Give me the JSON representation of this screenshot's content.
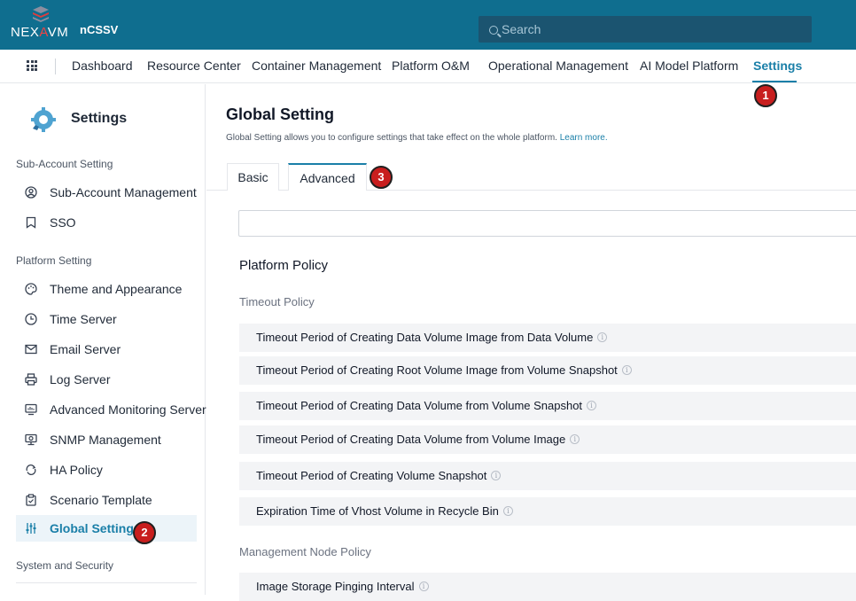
{
  "app": {
    "logo": {
      "part1": "NEX",
      "part2": "A",
      "part3": "VM"
    },
    "product": "nCSSV",
    "search_placeholder": "Search"
  },
  "nav": {
    "items": [
      "Dashboard",
      "Resource Center",
      "Container Management",
      "Platform O&M",
      "Operational Management",
      "AI Model Platform",
      "Settings"
    ],
    "active": "Settings"
  },
  "badges": [
    "1",
    "2",
    "3"
  ],
  "sidebar": {
    "title": "Settings",
    "groups": {
      "sub_account": "Sub-Account Setting",
      "platform": "Platform Setting",
      "system": "System and Security"
    },
    "items": [
      {
        "label": "Sub-Account Management",
        "icon": "user-circle-icon"
      },
      {
        "label": "SSO",
        "icon": "bookmark-icon"
      },
      {
        "label": "Theme and Appearance",
        "icon": "palette-icon"
      },
      {
        "label": "Time Server",
        "icon": "clock-icon"
      },
      {
        "label": "Email Server",
        "icon": "mail-icon"
      },
      {
        "label": "Log Server",
        "icon": "printer-icon"
      },
      {
        "label": "Advanced Monitoring Server",
        "icon": "monitor-icon"
      },
      {
        "label": "SNMP Management",
        "icon": "snmp-icon"
      },
      {
        "label": "HA Policy",
        "icon": "ha-icon"
      },
      {
        "label": "Scenario Template",
        "icon": "clipboard-icon"
      },
      {
        "label": "Global Setting",
        "icon": "sliders-icon"
      }
    ],
    "active": "Global Setting"
  },
  "main": {
    "title": "Global Setting",
    "description": "Global Setting allows you to configure settings that take effect on the whole platform.",
    "learn_more": "Learn more.",
    "tabs": [
      "Basic",
      "Advanced"
    ],
    "active_tab": "Advanced",
    "filter_value": "",
    "section": "Platform Policy",
    "subsections": {
      "timeout": "Timeout Policy",
      "mgmt": "Management Node Policy"
    },
    "timeout_items": [
      "Timeout Period of Creating Data Volume Image from Data Volume",
      "Timeout Period of Creating Root Volume Image from Volume Snapshot",
      "Timeout Period of Creating Data Volume from Volume Snapshot",
      "Timeout Period of Creating Data Volume from Volume Image",
      "Timeout Period of Creating Volume Snapshot",
      "Expiration Time of Vhost Volume in Recycle Bin"
    ],
    "mgmt_items": [
      "Image Storage Pinging Interval"
    ],
    "info_glyph": "i"
  },
  "colors": {
    "topbar": "#0f6e8f",
    "accent": "#1a7fa8",
    "badge": "#c81e1e",
    "row_bg": "#f3f4f6"
  }
}
